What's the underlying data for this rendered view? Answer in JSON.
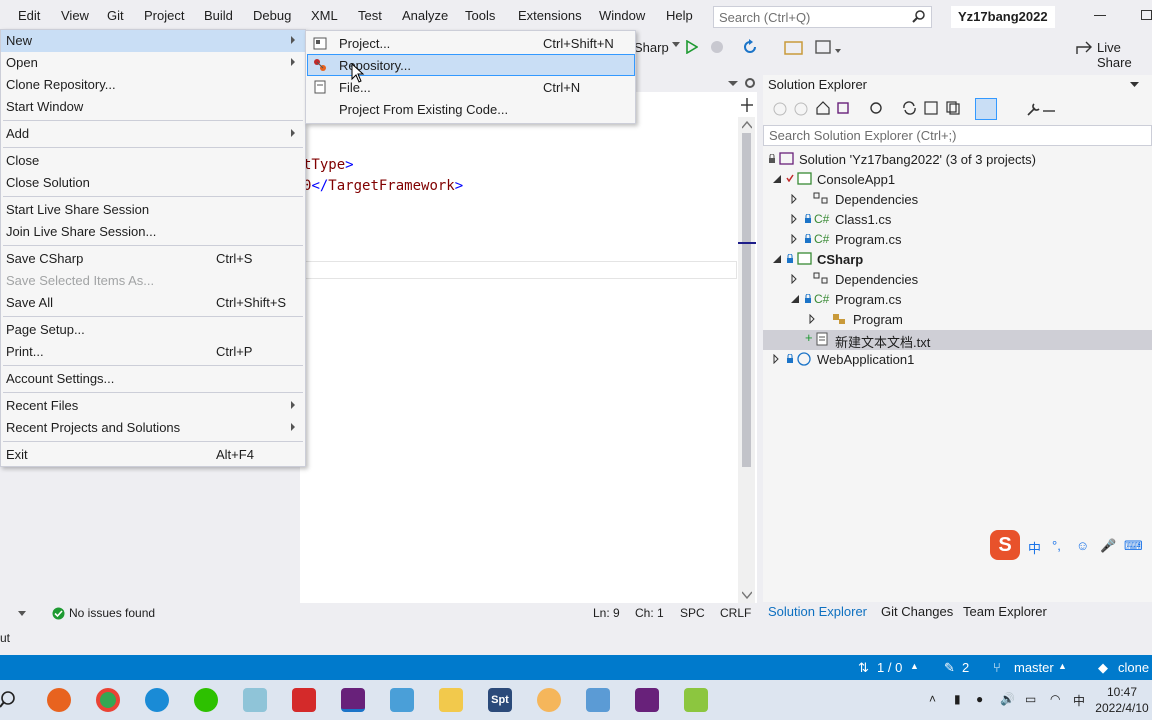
{
  "menubar": {
    "items": [
      "Edit",
      "View",
      "Git",
      "Project",
      "Build",
      "Debug",
      "XML",
      "Test",
      "Analyze",
      "Tools",
      "Extensions",
      "Window",
      "Help"
    ],
    "search_placeholder": "Search (Ctrl+Q)",
    "solution_name": "Yz17bang2022"
  },
  "toolbar": {
    "startup_project": "Sharp",
    "live_share": "Live Share"
  },
  "editor": {
    "line1_text": "tType",
    "line2_text": "0",
    "line2_tag": "TargetFramework"
  },
  "editor_status": {
    "issues": "No issues found",
    "ln": "Ln: 9",
    "ch": "Ch: 1",
    "spc": "SPC",
    "crlf": "CRLF"
  },
  "output": {
    "label": "ut"
  },
  "file_menu": {
    "items": [
      {
        "label": "New",
        "shortcut": "",
        "submenu": true
      },
      {
        "label": "Open",
        "shortcut": "",
        "submenu": true
      },
      {
        "label": "Clone Repository...",
        "shortcut": ""
      },
      {
        "label": "Start Window",
        "shortcut": ""
      },
      {
        "label": "Add",
        "shortcut": "",
        "submenu": true
      },
      {
        "label": "Close",
        "shortcut": ""
      },
      {
        "label": "Close Solution",
        "shortcut": ""
      },
      {
        "label": "Start Live Share Session",
        "shortcut": ""
      },
      {
        "label": "Join Live Share Session...",
        "shortcut": ""
      },
      {
        "label": "Save CSharp",
        "shortcut": "Ctrl+S"
      },
      {
        "label": "Save Selected Items As...",
        "shortcut": "",
        "disabled": true
      },
      {
        "label": "Save All",
        "shortcut": "Ctrl+Shift+S"
      },
      {
        "label": "Page Setup...",
        "shortcut": ""
      },
      {
        "label": "Print...",
        "shortcut": "Ctrl+P"
      },
      {
        "label": "Account Settings...",
        "shortcut": ""
      },
      {
        "label": "Recent Files",
        "shortcut": "",
        "submenu": true
      },
      {
        "label": "Recent Projects and Solutions",
        "shortcut": "",
        "submenu": true
      },
      {
        "label": "Exit",
        "shortcut": "Alt+F4"
      }
    ]
  },
  "new_submenu": {
    "items": [
      {
        "label": "Project...",
        "shortcut": "Ctrl+Shift+N"
      },
      {
        "label": "Repository...",
        "shortcut": ""
      },
      {
        "label": "File...",
        "shortcut": "Ctrl+N"
      },
      {
        "label": "Project From Existing Code...",
        "shortcut": ""
      }
    ]
  },
  "solution_explorer": {
    "title": "Solution Explorer",
    "search_placeholder": "Search Solution Explorer (Ctrl+;)",
    "tree": [
      {
        "label": "Solution 'Yz17bang2022' (3 of 3 projects)"
      },
      {
        "label": "ConsoleApp1"
      },
      {
        "label": "Dependencies"
      },
      {
        "label": "Class1.cs"
      },
      {
        "label": "Program.cs"
      },
      {
        "label": "CSharp"
      },
      {
        "label": "Dependencies"
      },
      {
        "label": "Program.cs"
      },
      {
        "label": "Program"
      },
      {
        "label": "新建文本文档.txt"
      },
      {
        "label": "WebApplication1"
      }
    ],
    "tabs": [
      "Solution Explorer",
      "Git Changes",
      "Team Explorer"
    ]
  },
  "statusbar": {
    "sync": "1 / 0",
    "edits": "2",
    "branch": "master",
    "repo": "clone"
  },
  "ime": {
    "logo": "S",
    "mode": "中"
  },
  "taskbar": {
    "app_icons": [
      "search-icon",
      "firefox-icon",
      "chrome-icon",
      "edge-icon",
      "wechat-icon",
      "notepad-icon",
      "wps-icon",
      "vs-preview-icon",
      "app-icon",
      "file-explorer-icon",
      "spt-icon",
      "lamp-icon",
      "app2-icon",
      "visual-studio-icon",
      "notepadpp-icon"
    ],
    "spt_label": "Spt",
    "ime_lang": "中",
    "time": "10:47",
    "date": "2022/4/10"
  },
  "colors": {
    "accent": "#007acc",
    "menu_highlight": "#c9def5",
    "sel_border": "#3399ff"
  }
}
